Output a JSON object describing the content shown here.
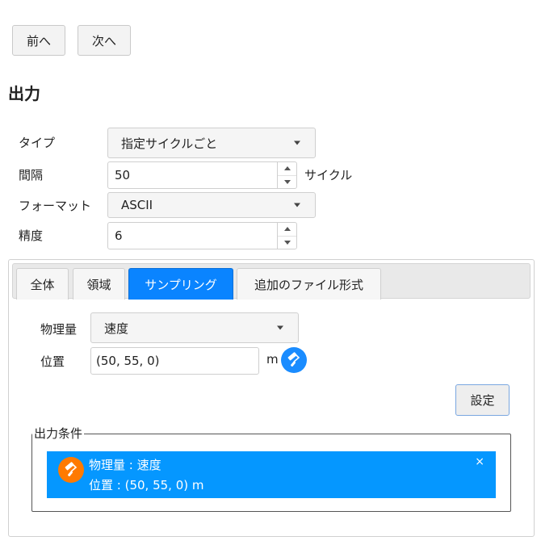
{
  "nav": {
    "prev_label": "前へ",
    "next_label": "次へ"
  },
  "page_title": "出力",
  "form": {
    "type_label": "タイプ",
    "type_value": "指定サイクルごと",
    "interval_label": "間隔",
    "interval_value": "50",
    "interval_unit": "サイクル",
    "format_label": "フォーマット",
    "format_value": "ASCII",
    "precision_label": "精度",
    "precision_value": "6"
  },
  "tabs": [
    {
      "label": "全体",
      "active": false
    },
    {
      "label": "領域",
      "active": false
    },
    {
      "label": "サンプリング",
      "active": true
    },
    {
      "label": "追加のファイル形式",
      "active": false
    }
  ],
  "sampling": {
    "quantity_label": "物理量",
    "quantity_value": "速度",
    "position_label": "位置",
    "position_value": "(50, 55, 0)",
    "position_unit": "m",
    "set_button": "設定"
  },
  "conditions": {
    "legend": "出力条件",
    "items": [
      {
        "line1": "物理量 : 速度",
        "line2": "位置 : (50, 55, 0) m",
        "close": "×"
      }
    ]
  },
  "colors": {
    "active_tab": "#0a84ff",
    "condition_bg": "#0597ff",
    "pick_icon_bg": "#1a8cff",
    "condition_icon_bg": "#ff7a00"
  },
  "icons": {
    "pick": "paint-roller-icon",
    "condition": "paint-roller-icon",
    "close": "close-icon"
  }
}
